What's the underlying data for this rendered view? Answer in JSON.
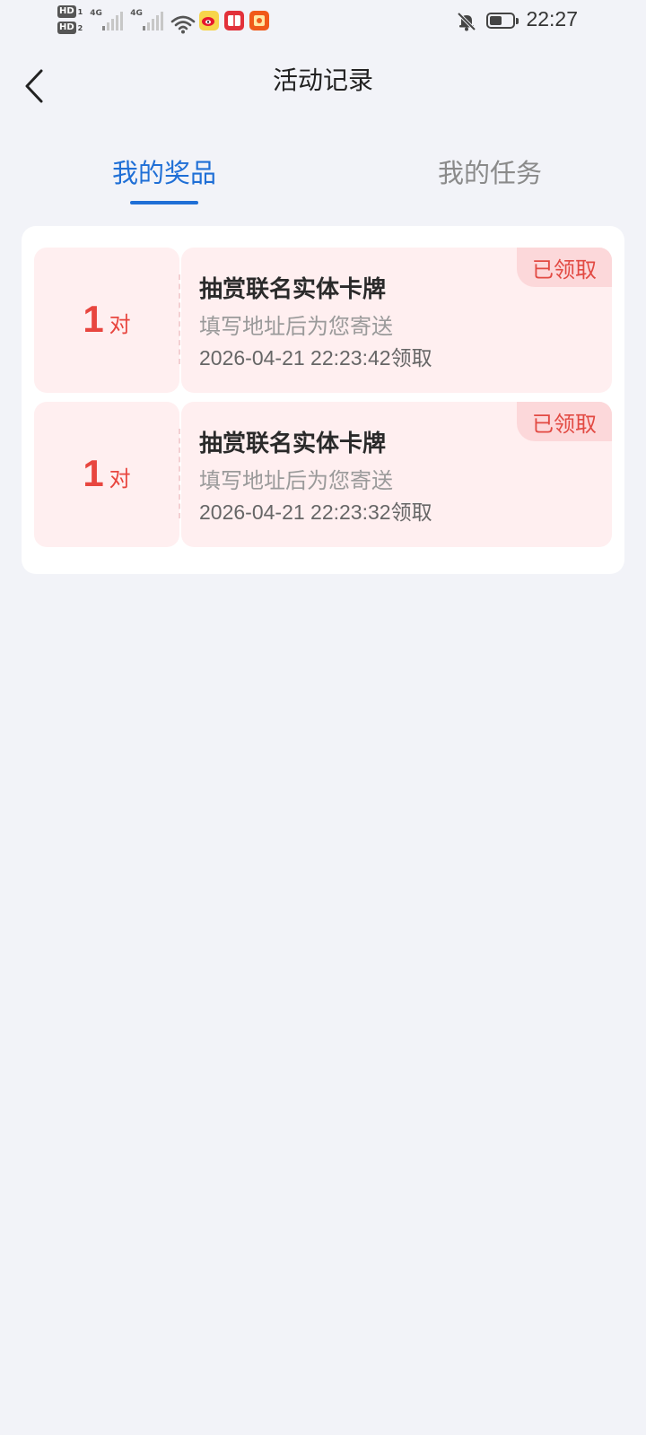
{
  "status_bar": {
    "time": "22:27",
    "hd1": "HD",
    "hd1_num": "1",
    "hd2": "HD",
    "hd2_num": "2",
    "network1": "4G",
    "network2": "4G",
    "battery_level": 0.55,
    "icons": [
      "wifi-icon",
      "weibo-icon",
      "book-app-icon",
      "red-envelope-icon",
      "bell-off-icon",
      "battery-icon"
    ]
  },
  "header": {
    "title": "活动记录"
  },
  "tabs": [
    {
      "label": "我的奖品",
      "active": true
    },
    {
      "label": "我的任务",
      "active": false
    }
  ],
  "prizes": [
    {
      "quantity": "1",
      "unit": "对",
      "name": "抽赏联名实体卡牌",
      "desc": "填写地址后为您寄送",
      "time": "2026-04-21 22:23:42领取",
      "status": "已领取"
    },
    {
      "quantity": "1",
      "unit": "对",
      "name": "抽赏联名实体卡牌",
      "desc": "填写地址后为您寄送",
      "time": "2026-04-21 22:23:32领取",
      "status": "已领取"
    }
  ],
  "colors": {
    "accent": "#1f6fd6",
    "prize_red": "#e8463f",
    "card_bg": "#ffeff0",
    "page_bg": "#f2f3f8"
  }
}
